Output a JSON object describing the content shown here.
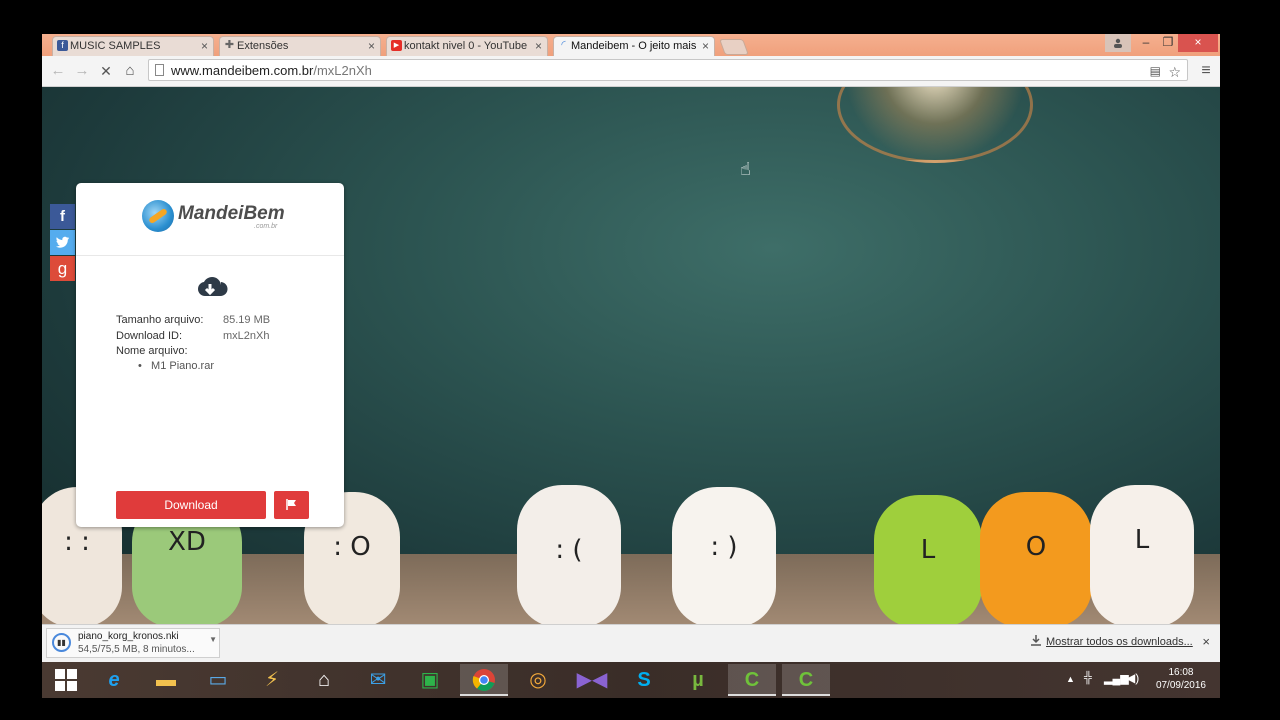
{
  "browser": {
    "tabs": [
      {
        "title": "MUSIC SAMPLES",
        "icon": "facebook-icon",
        "active": false
      },
      {
        "title": "Extensões",
        "icon": "puzzle-icon",
        "active": false
      },
      {
        "title": "kontakt nivel 0 - YouTube",
        "icon": "youtube-icon",
        "active": false
      },
      {
        "title": "Mandeibem - O jeito mais",
        "icon": "loading-icon",
        "active": true
      }
    ],
    "close_glyph": "×",
    "url_host": "www.mandeibem.com.br",
    "url_path": "/mxL2nXh"
  },
  "card": {
    "logo_text": "MandeiBem",
    "logo_sub": ".com.br",
    "size_label": "Tamanho arquivo:",
    "size_value": "85.19 MB",
    "id_label": "Download ID:",
    "id_value": "mxL2nXh",
    "name_label": "Nome arquivo:",
    "file_name": "M1 Piano.rar",
    "download_label": "Download"
  },
  "social": {
    "facebook": "f",
    "google": "g"
  },
  "download_shelf": {
    "file_name": "piano_korg_kronos.nki",
    "status": "54,5/75,5 MB, 8 minutos...",
    "show_all": "Mostrar todos os downloads..."
  },
  "taskbar": {
    "time": "16:08",
    "date": "07/09/2016"
  }
}
